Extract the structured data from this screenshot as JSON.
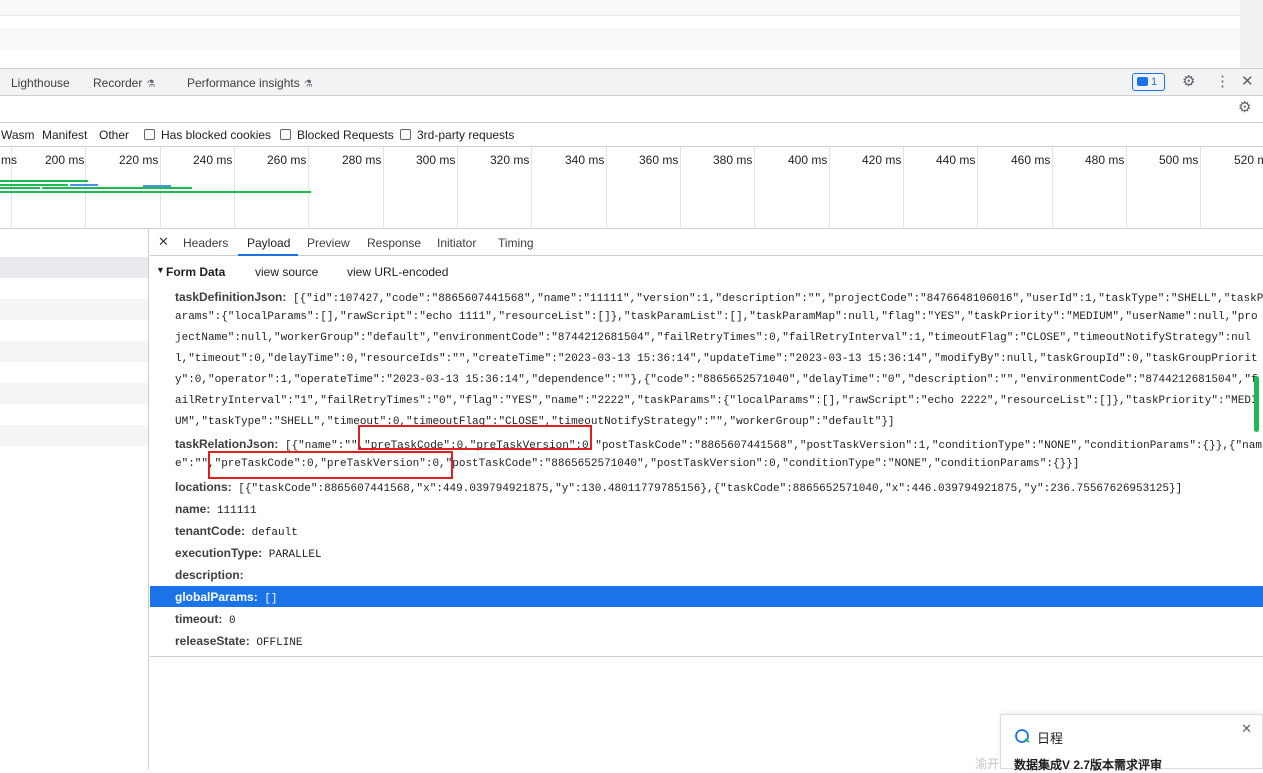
{
  "devtools_tabs": [
    {
      "label": "Lighthouse"
    },
    {
      "label": "Recorder",
      "experimental": true
    },
    {
      "label": "Performance insights",
      "experimental": true
    }
  ],
  "issues_count": "1",
  "filter": {
    "types": [
      "Wasm",
      "Manifest",
      "Other"
    ],
    "checkboxes": [
      "Has blocked cookies",
      "Blocked Requests",
      "3rd-party requests"
    ]
  },
  "timeline_ticks": [
    "ms",
    "200 ms",
    "220 ms",
    "240 ms",
    "260 ms",
    "280 ms",
    "300 ms",
    "320 ms",
    "340 ms",
    "360 ms",
    "380 ms",
    "400 ms",
    "420 ms",
    "440 ms",
    "460 ms",
    "480 ms",
    "500 ms",
    "520 ms"
  ],
  "detail_tabs": [
    "Headers",
    "Payload",
    "Preview",
    "Response",
    "Initiator",
    "Timing"
  ],
  "active_tab": "Payload",
  "form_data": {
    "title": "Form Data",
    "view_source": "view source",
    "view_url_encoded": "view URL-encoded"
  },
  "fields": {
    "taskDefinitionJson_label": "taskDefinitionJson:",
    "taskDefinitionJson_lines": [
      "[{\"id\":107427,\"code\":\"8865607441568\",\"name\":\"11111\",\"version\":1,\"description\":\"\",\"projectCode\":\"8476648106016\",\"userId\":1,\"taskType\":\"SHELL\",\"taskP",
      "arams\":{\"localParams\":[],\"rawScript\":\"echo 1111\",\"resourceList\":[]},\"taskParamList\":[],\"taskParamMap\":null,\"flag\":\"YES\",\"taskPriority\":\"MEDIUM\",\"userName\":null,\"pro",
      "jectName\":null,\"workerGroup\":\"default\",\"environmentCode\":\"8744212681504\",\"failRetryTimes\":0,\"failRetryInterval\":1,\"timeoutFlag\":\"CLOSE\",\"timeoutNotifyStrategy\":nul",
      "l,\"timeout\":0,\"delayTime\":0,\"resourceIds\":\"\",\"createTime\":\"2023-03-13 15:36:14\",\"updateTime\":\"2023-03-13 15:36:14\",\"modifyBy\":null,\"taskGroupId\":0,\"taskGroupPriorit",
      "y\":0,\"operator\":1,\"operateTime\":\"2023-03-13 15:36:14\",\"dependence\":\"\"},{\"code\":\"8865652571040\",\"delayTime\":\"0\",\"description\":\"\",\"environmentCode\":\"8744212681504\",\"f",
      "ailRetryInterval\":\"1\",\"failRetryTimes\":\"0\",\"flag\":\"YES\",\"name\":\"2222\",\"taskParams\":{\"localParams\":[],\"rawScript\":\"echo 2222\",\"resourceList\":[]},\"taskPriority\":\"MEDI",
      "UM\",\"taskType\":\"SHELL\",\"timeout\":0,\"timeoutFlag\":\"CLOSE\",\"timeoutNotifyStrategy\":\"\",\"workerGroup\":\"default\"}]"
    ],
    "taskRelationJson_label": "taskRelationJson:",
    "taskRelationJson_lines": [
      "[{\"name\":\"\",\"preTaskCode\":0,\"preTaskVersion\":0,\"postTaskCode\":\"8865607441568\",\"postTaskVersion\":1,\"conditionType\":\"NONE\",\"conditionParams\":{}},{\"nam",
      "e\":\"\",\"preTaskCode\":0,\"preTaskVersion\":0,\"postTaskCode\":\"8865652571040\",\"postTaskVersion\":0,\"conditionType\":\"NONE\",\"conditionParams\":{}}]"
    ],
    "locations_label": "locations:",
    "locations_value": "[{\"taskCode\":8865607441568,\"x\":449.039794921875,\"y\":130.48011779785156},{\"taskCode\":8865652571040,\"x\":446.039794921875,\"y\":236.75567626953125}]",
    "name_label": "name:",
    "name_value": "111111",
    "tenantCode_label": "tenantCode:",
    "tenantCode_value": "default",
    "executionType_label": "executionType:",
    "executionType_value": "PARALLEL",
    "description_label": "description:",
    "description_value": "",
    "globalParams_label": "globalParams:",
    "globalParams_value": "[]",
    "timeout_label": "timeout:",
    "timeout_value": "0",
    "releaseState_label": "releaseState:",
    "releaseState_value": "OFFLINE"
  },
  "notification": {
    "title": "日程",
    "subtitle": "数据集成V 2.7版本需求评审",
    "watermark": "渝开..."
  },
  "colors": {
    "accent": "#1a73e8",
    "highlight_box": "#e02020",
    "scroll_thumb": "#1db954"
  }
}
